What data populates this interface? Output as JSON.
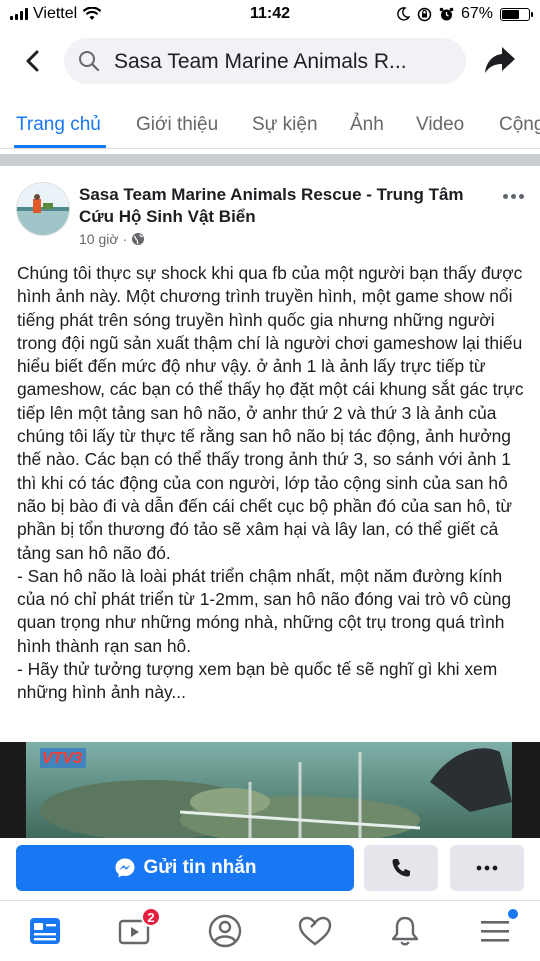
{
  "status_bar": {
    "carrier": "Viettel",
    "time": "11:42",
    "battery": "67%",
    "battery_level": 0.67
  },
  "header": {
    "search_text": "Sasa Team Marine Animals R..."
  },
  "tabs": [
    {
      "label": "Trang chủ",
      "active": true
    },
    {
      "label": "Giới thiệu",
      "active": false
    },
    {
      "label": "Sự kiện",
      "active": false
    },
    {
      "label": "Ảnh",
      "active": false
    },
    {
      "label": "Video",
      "active": false
    },
    {
      "label": "Cộng",
      "active": false
    }
  ],
  "post": {
    "page_name": "Sasa Team Marine Animals Rescue - Trung Tâm Cứu Hộ Sinh Vật Biển",
    "time": "10 giờ",
    "privacy_icon": "globe-icon",
    "paragraphs": [
      "Chúng tôi thực sự shock khi qua fb của một người bạn thấy được hình ảnh này. Một chương trình truyền hình, một game show nổi tiếng phát trên sóng truyền hình quốc gia nhưng những người trong đội ngũ sản xuất thậm chí là người chơi gameshow lại thiếu hiểu biết đến mức độ như vậy. ở ảnh 1 là ảnh lấy trực tiếp từ gameshow, các bạn có thể thấy họ đặt một cái khung sắt gác trực tiếp lên một tảng san hô não, ở anhr thứ 2 và thứ 3 là ảnh của chúng tôi lấy từ thực tế rằng san hô não bị tác động, ảnh hưởng thế nào. Các bạn có thể thấy trong ảnh thứ 3, so sánh với ảnh 1 thì khi có tác động của con người, lớp tảo cộng sinh của san hô não bị bào đi và dẫn đến cái chết cục bộ phần đó của san hô, từ phần bị tổn thương đó tảo sẽ xâm hại và lây lan, có thể giết cả tảng san hô não đó.",
      "- San hô não là loài phát triển chậm nhất, một năm đường kính của nó chỉ phát triển từ 1-2mm, san hô não đóng vai trò vô cùng quan trọng như những móng nhà, những cột trụ trong quá trình hình thành rạn san hô.",
      "- Hãy thử tưởng tượng xem bạn bè quốc tế sẽ nghĩ gì khi xem những hình ảnh này..."
    ],
    "video_logo": "VTV3"
  },
  "actions": {
    "message_label": "Gửi tin nhắn"
  },
  "navbar": {
    "video_badge": "2"
  },
  "colors": {
    "accent": "#1877f2",
    "badge": "#e41e3f"
  }
}
